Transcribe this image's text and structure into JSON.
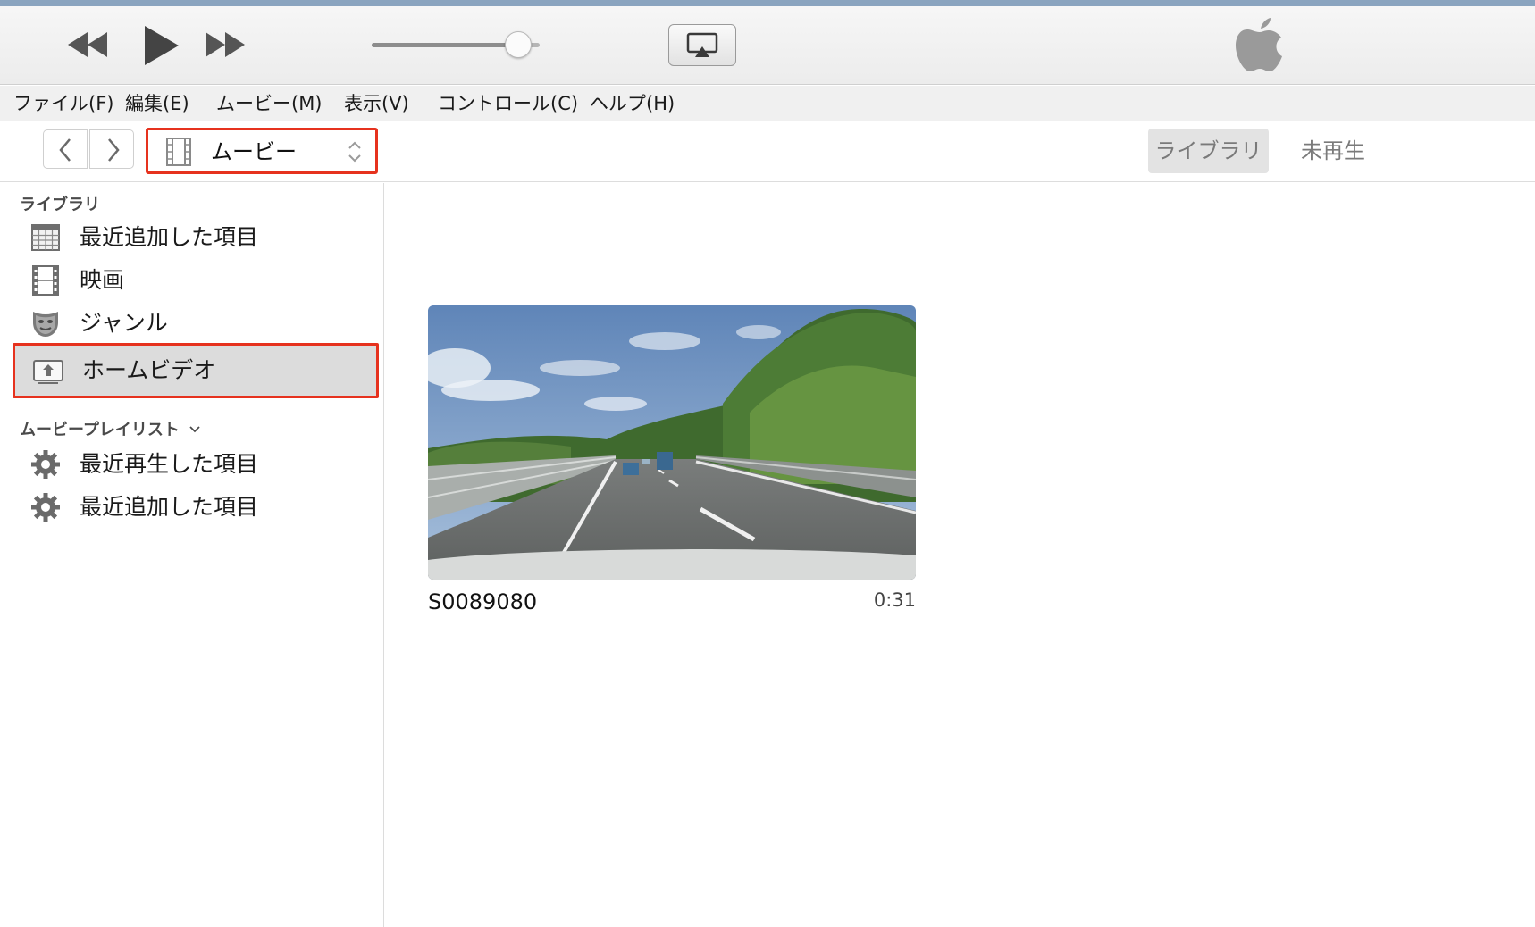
{
  "player": {
    "volume_level": 0.87,
    "icons": [
      "rewind-icon",
      "play-icon",
      "fast-forward-icon",
      "airplay-icon",
      "apple-logo-icon"
    ]
  },
  "menubar": {
    "items": [
      "ファイル(F)",
      "編集(E)",
      "ムービー(M)",
      "表示(V)",
      "コントロール(C)",
      "ヘルプ(H)"
    ]
  },
  "navbar": {
    "media_kind": "ムービー",
    "tabs": {
      "library": "ライブラリ",
      "unplayed": "未再生"
    }
  },
  "sidebar": {
    "library_heading": "ライブラリ",
    "library_items": [
      {
        "label": "最近追加した項目",
        "icon": "grid-icon"
      },
      {
        "label": "映画",
        "icon": "film-icon"
      },
      {
        "label": "ジャンル",
        "icon": "masks-icon"
      },
      {
        "label": "ホームビデオ",
        "icon": "home-video-icon",
        "selected": true
      }
    ],
    "playlists_heading": "ムービープレイリスト",
    "playlist_items": [
      {
        "label": "最近再生した項目",
        "icon": "gear-icon"
      },
      {
        "label": "最近追加した項目",
        "icon": "gear-icon"
      }
    ]
  },
  "main": {
    "videos": [
      {
        "title": "S0089080",
        "duration": "0:31"
      }
    ]
  },
  "colors": {
    "highlight_border": "#e6321e",
    "selected_bg": "#dcdcdc",
    "tab_active_bg": "#e3e3e3"
  }
}
